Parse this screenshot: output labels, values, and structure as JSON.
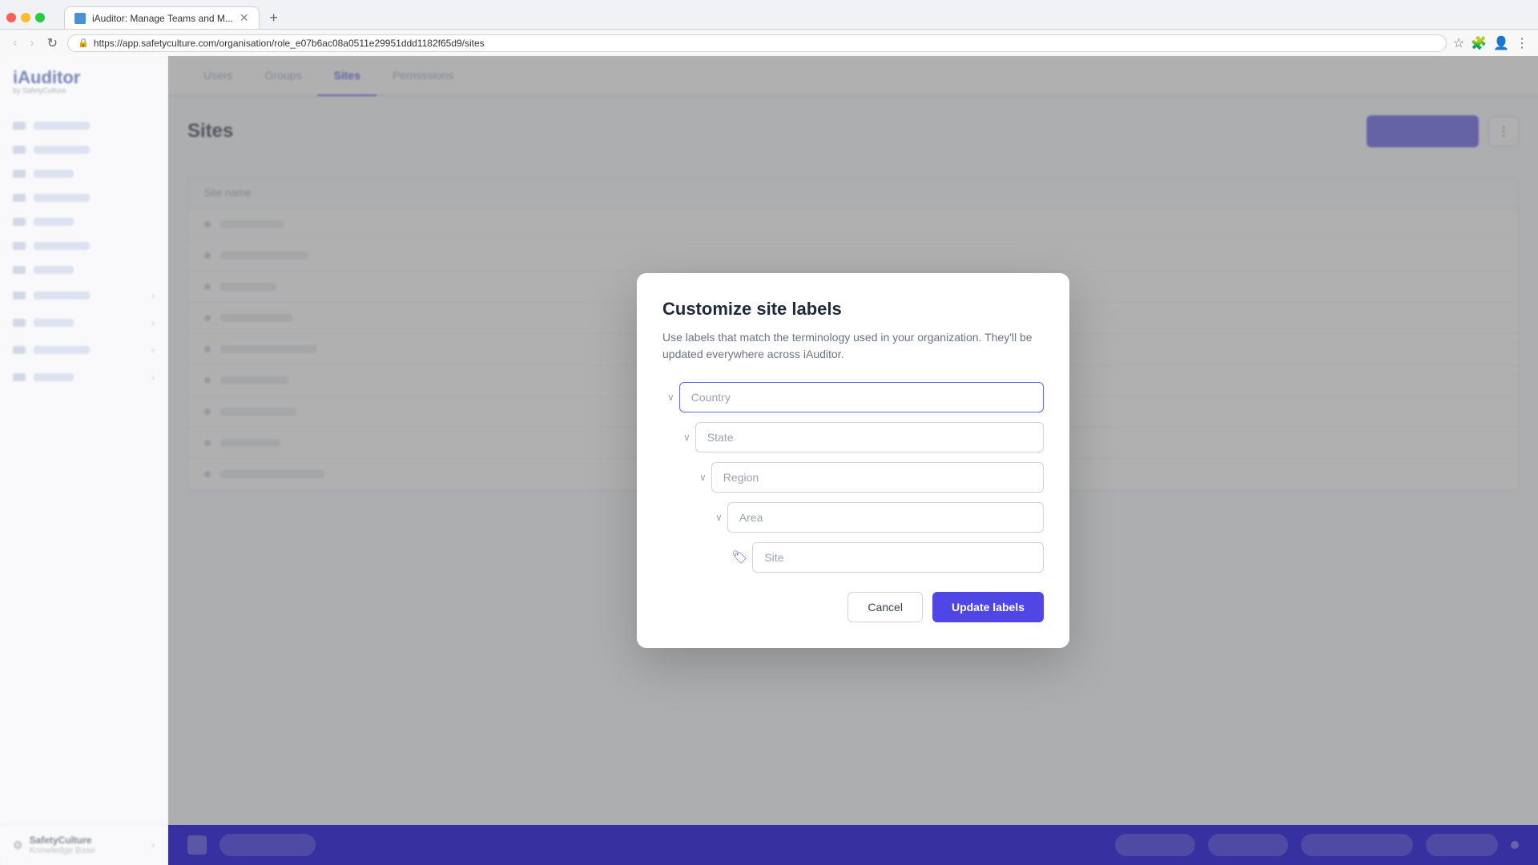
{
  "browser": {
    "tab_title": "iAuditor: Manage Teams and M...",
    "url": "https://app.safetyculture.com/organisation/role_e07b6ac08a0511e29951ddd1182f65d9/sites",
    "new_tab_label": "+"
  },
  "app": {
    "logo_main": "iAuditor",
    "logo_sub": "by SafetyCulture"
  },
  "nav_tabs": {
    "items": [
      {
        "label": "Users",
        "active": false
      },
      {
        "label": "Groups",
        "active": false
      },
      {
        "label": "Sites",
        "active": true
      },
      {
        "label": "Permissions",
        "active": false
      }
    ]
  },
  "page": {
    "title": "Sites"
  },
  "modal": {
    "title": "Customize site labels",
    "description": "Use labels that match the terminology used in your organization. They'll be updated everywhere across iAuditor.",
    "fields": [
      {
        "id": "country",
        "placeholder": "Country",
        "value": "",
        "indent": 0,
        "icon": "chevron",
        "focused": true
      },
      {
        "id": "state",
        "placeholder": "State",
        "value": "",
        "indent": 1,
        "icon": "chevron",
        "focused": false
      },
      {
        "id": "region",
        "placeholder": "Region",
        "value": "",
        "indent": 2,
        "icon": "chevron",
        "focused": false
      },
      {
        "id": "area",
        "placeholder": "Area",
        "value": "",
        "indent": 3,
        "icon": "chevron",
        "focused": false
      },
      {
        "id": "site",
        "placeholder": "Site",
        "value": "",
        "indent": 4,
        "icon": "tag",
        "focused": false
      }
    ],
    "cancel_label": "Cancel",
    "update_label": "Update labels"
  }
}
